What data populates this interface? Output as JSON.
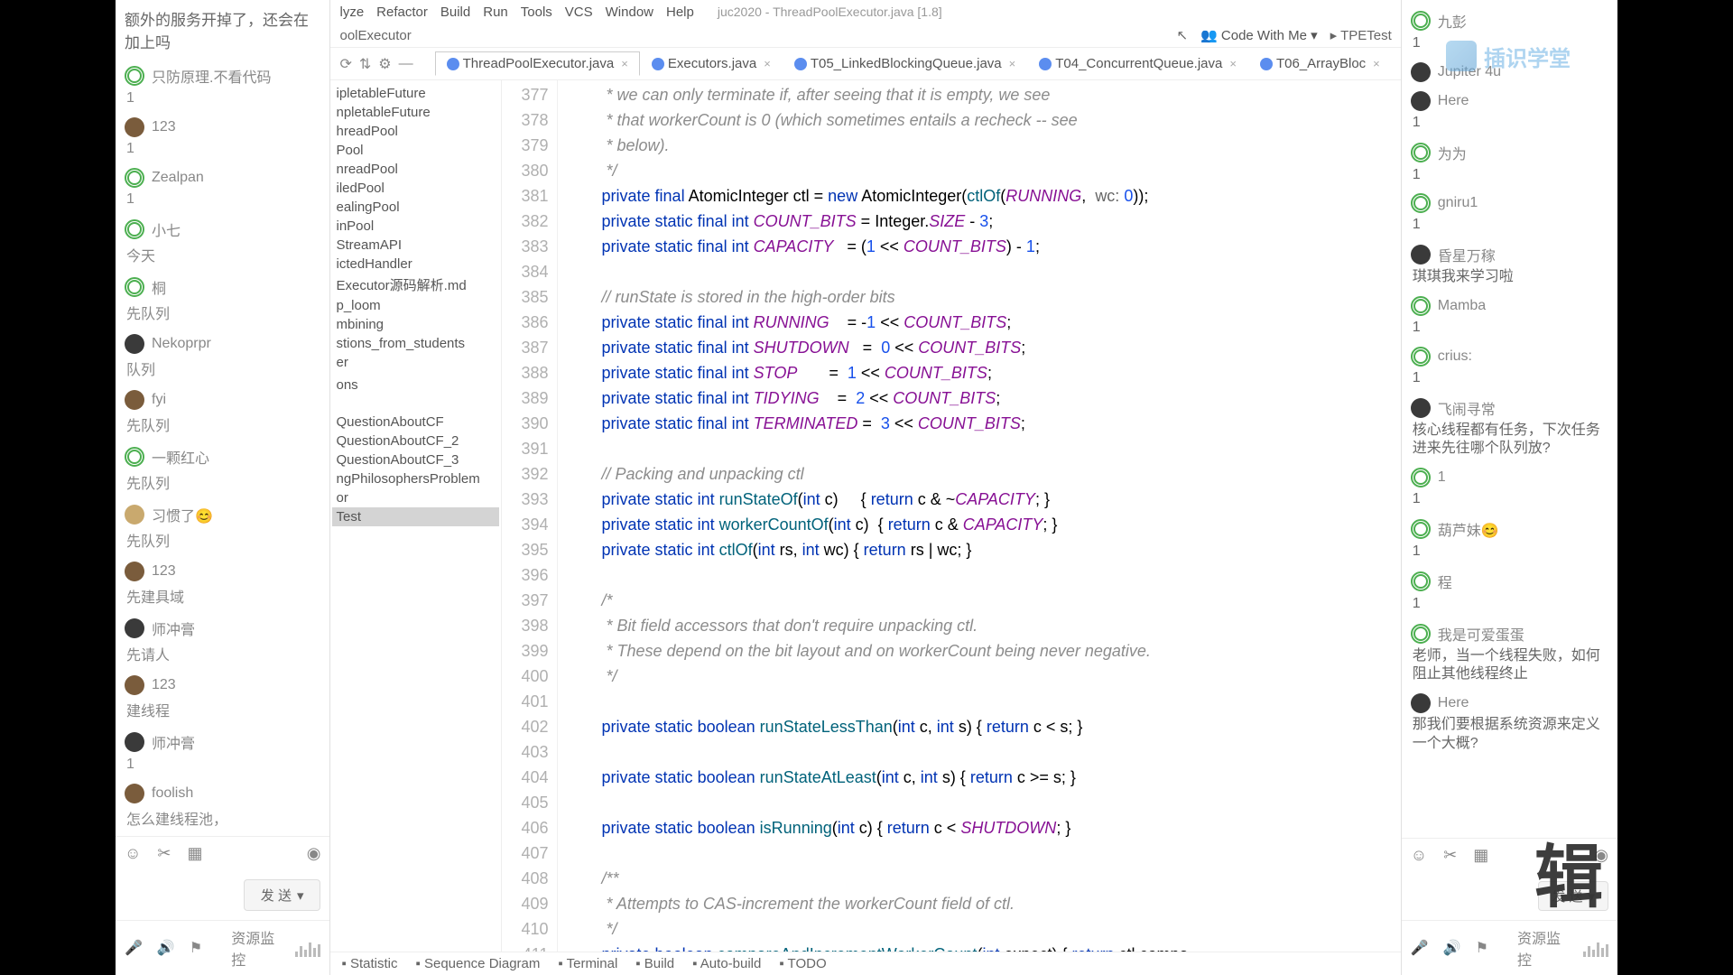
{
  "left": {
    "top_msg": "额外的服务开掉了，还会在加上吗",
    "users": [
      {
        "name": "只防原理.不看代码",
        "sub": "1",
        "av": "green"
      },
      {
        "name": "123",
        "sub": "1",
        "av": "brown"
      },
      {
        "name": "Zealpan",
        "sub": "1",
        "av": "green"
      },
      {
        "name": "小七",
        "sub": "今天",
        "av": "green"
      },
      {
        "name": "桐",
        "sub": "先队列",
        "av": "green"
      },
      {
        "name": "Nekoprpr",
        "sub": "队列",
        "av": "dark"
      },
      {
        "name": "fyi",
        "sub": "先队列",
        "av": "brown"
      },
      {
        "name": "一颗红心",
        "sub": "先队列",
        "av": "green"
      },
      {
        "name": "习惯了😊",
        "sub": "先队列",
        "av": "gold"
      },
      {
        "name": "123",
        "sub": "先建具域",
        "av": "brown"
      },
      {
        "name": "师冲膏",
        "sub": "先请人",
        "av": "dark"
      },
      {
        "name": "123",
        "sub": "建线程",
        "av": "brown"
      },
      {
        "name": "师冲膏",
        "sub": "1",
        "av": "dark"
      },
      {
        "name": "foolish",
        "sub": "怎么建线程池，",
        "av": "brown"
      }
    ],
    "send": "发 送",
    "monitor": "资源监控"
  },
  "ide": {
    "menu": [
      "lyze",
      "Refactor",
      "Build",
      "Run",
      "Tools",
      "VCS",
      "Window",
      "Help"
    ],
    "title": "juc2020 - ThreadPoolExecutor.java [1.8]",
    "breadcrumb": "oolExecutor",
    "code_with_me": "Code With Me",
    "tpe_test": "TPETest",
    "tabs": [
      {
        "label": "ThreadPoolExecutor.java",
        "active": true
      },
      {
        "label": "Executors.java",
        "active": false
      },
      {
        "label": "T05_LinkedBlockingQueue.java",
        "active": false
      },
      {
        "label": "T04_ConcurrentQueue.java",
        "active": false
      },
      {
        "label": "T06_ArrayBloc",
        "active": false
      }
    ],
    "tree": [
      "ipletableFuture",
      "npletableFuture",
      "hreadPool",
      "Pool",
      "nreadPool",
      "iledPool",
      "ealingPool",
      "inPool",
      "StreamAPI",
      "ictedHandler",
      "Executor源码解析.md",
      "p_loom",
      "mbining",
      "stions_from_students",
      "er",
      "",
      "ons",
      "",
      "",
      "",
      "",
      "",
      "QuestionAboutCF",
      "QuestionAboutCF_2",
      "QuestionAboutCF_3",
      "ngPhilosophersProblem",
      "or",
      "Test"
    ],
    "line_start": 377,
    "tool_windows": [
      "Statistic",
      "Sequence Diagram",
      "Terminal",
      "Build",
      "Auto-build",
      "TODO"
    ]
  },
  "code": [
    {
      "t": "com",
      "txt": "     * we can only terminate if, after seeing that it is empty, we see"
    },
    {
      "t": "com",
      "txt": "     * that workerCount is 0 (which sometimes entails a recheck -- see"
    },
    {
      "t": "com",
      "txt": "     * below)."
    },
    {
      "t": "com",
      "txt": "     */"
    },
    {
      "t": "code",
      "txt": "    private final AtomicInteger ctl = new AtomicInteger(ctlOf(RUNNING,  wc: 0));"
    },
    {
      "t": "code",
      "txt": "    private static final int COUNT_BITS = Integer.SIZE - 3;"
    },
    {
      "t": "code",
      "txt": "    private static final int CAPACITY   = (1 << COUNT_BITS) - 1;"
    },
    {
      "t": "blank",
      "txt": ""
    },
    {
      "t": "com",
      "txt": "    // runState is stored in the high-order bits"
    },
    {
      "t": "code",
      "txt": "    private static final int RUNNING    = -1 << COUNT_BITS;"
    },
    {
      "t": "code",
      "txt": "    private static final int SHUTDOWN   =  0 << COUNT_BITS;"
    },
    {
      "t": "code",
      "txt": "    private static final int STOP       =  1 << COUNT_BITS;"
    },
    {
      "t": "code",
      "txt": "    private static final int TIDYING    =  2 << COUNT_BITS;"
    },
    {
      "t": "code",
      "txt": "    private static final int TERMINATED =  3 << COUNT_BITS;"
    },
    {
      "t": "blank",
      "txt": ""
    },
    {
      "t": "com",
      "txt": "    // Packing and unpacking ctl"
    },
    {
      "t": "code",
      "txt": "    private static int runStateOf(int c)     { return c & ~CAPACITY; }"
    },
    {
      "t": "code",
      "txt": "    private static int workerCountOf(int c)  { return c & CAPACITY; }"
    },
    {
      "t": "code",
      "txt": "    private static int ctlOf(int rs, int wc) { return rs | wc; }"
    },
    {
      "t": "blank",
      "txt": ""
    },
    {
      "t": "com",
      "txt": "    /*"
    },
    {
      "t": "com",
      "txt": "     * Bit field accessors that don't require unpacking ctl."
    },
    {
      "t": "com",
      "txt": "     * These depend on the bit layout and on workerCount being never negative."
    },
    {
      "t": "com",
      "txt": "     */"
    },
    {
      "t": "blank",
      "txt": ""
    },
    {
      "t": "code",
      "txt": "    private static boolean runStateLessThan(int c, int s) { return c < s; }"
    },
    {
      "t": "blank",
      "txt": ""
    },
    {
      "t": "code",
      "txt": "    private static boolean runStateAtLeast(int c, int s) { return c >= s; }"
    },
    {
      "t": "blank",
      "txt": ""
    },
    {
      "t": "code",
      "txt": "    private static boolean isRunning(int c) { return c < SHUTDOWN; }"
    },
    {
      "t": "blank",
      "txt": ""
    },
    {
      "t": "com",
      "txt": "    /**"
    },
    {
      "t": "com",
      "txt": "     * Attempts to CAS-increment the workerCount field of ctl."
    },
    {
      "t": "com",
      "txt": "     */"
    },
    {
      "t": "code",
      "txt": "    private boolean compareAndIncrementWorkerCount(int expect) { return ctl.compa"
    }
  ],
  "right": {
    "items": [
      {
        "name": "九彭",
        "msg": "1",
        "av": "green"
      },
      {
        "name": "Jupiter 4u",
        "msg": "",
        "av": "dark"
      },
      {
        "name": "Here",
        "msg": "1",
        "av": "dark"
      },
      {
        "name": "为为",
        "msg": "1",
        "av": "green"
      },
      {
        "name": "gniru1",
        "msg": "1",
        "av": "green"
      },
      {
        "name": "昏星万稼",
        "msg": "琪琪我来学习啦",
        "av": "dark"
      },
      {
        "name": "Mamba",
        "msg": "1",
        "av": "green"
      },
      {
        "name": "crius:",
        "msg": "1",
        "av": "green"
      },
      {
        "name": "飞闹寻常",
        "msg": "核心线程都有任务，下次任务进来先往哪个队列放?",
        "av": "dark"
      },
      {
        "name": "1",
        "msg": "1",
        "av": "green"
      },
      {
        "name": "葫芦妹😊",
        "msg": "1",
        "av": "green"
      },
      {
        "name": "程",
        "msg": "1",
        "av": "green"
      },
      {
        "name": "我是可爱蛋蛋",
        "msg": "老师，当一个线程失败，如何阻止其他线程终止",
        "av": "green"
      },
      {
        "name": "Here",
        "msg": "那我们要根据系统资源来定义一个大概?",
        "av": "dark"
      }
    ],
    "send": "发 送",
    "monitor": "资源监控"
  },
  "watermark": "插识学堂",
  "big_text": "辑"
}
